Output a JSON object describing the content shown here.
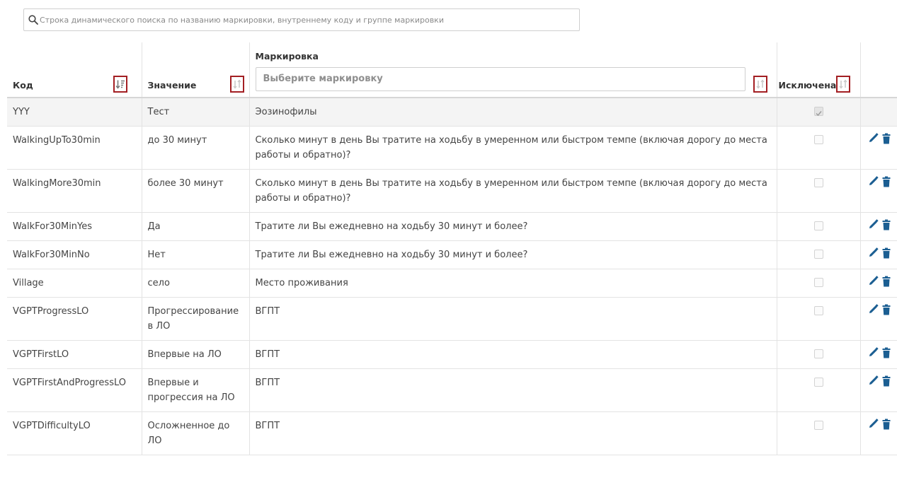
{
  "search": {
    "placeholder": "Строка динамического поиска по названию маркировки, внутреннему коду и группе маркировки"
  },
  "table": {
    "headers": {
      "code": "Код",
      "value": "Значение",
      "marking": "Маркировка",
      "marking_select_placeholder": "Выберите маркировку",
      "excluded": "Исключена"
    },
    "rows": [
      {
        "code": "YYY",
        "value": "Тест",
        "marking": "Эозинофилы",
        "excluded": true
      },
      {
        "code": "WalkingUpTo30min",
        "value": "до 30 минут",
        "marking": "Сколько минут в день Вы тратите на ходьбу в умеренном или быстром темпе (включая дорогу до места работы и обратно)?",
        "excluded": false
      },
      {
        "code": "WalkingMore30min",
        "value": "более 30 минут",
        "marking": "Сколько минут в день Вы тратите на ходьбу в умеренном или быстром темпе (включая дорогу до места работы и обратно)?",
        "excluded": false
      },
      {
        "code": "WalkFor30MinYes",
        "value": "Да",
        "marking": "Тратите ли Вы ежедневно на ходьбу 30 минут и более?",
        "excluded": false
      },
      {
        "code": "WalkFor30MinNo",
        "value": "Нет",
        "marking": "Тратите ли Вы ежедневно на ходьбу 30 минут и более?",
        "excluded": false
      },
      {
        "code": "Village",
        "value": "село",
        "marking": "Место проживания",
        "excluded": false
      },
      {
        "code": "VGPTProgressLO",
        "value": "Прогрессирование в ЛО",
        "marking": "ВГПТ",
        "excluded": false
      },
      {
        "code": "VGPTFirstLO",
        "value": "Впервые на ЛО",
        "marking": "ВГПТ",
        "excluded": false
      },
      {
        "code": "VGPTFirstAndProgressLO",
        "value": "Впервые и прогрессия на ЛО",
        "marking": "ВГПТ",
        "excluded": false
      },
      {
        "code": "VGPTDifficultyLO",
        "value": "Осложненное до ЛО",
        "marking": "ВГПТ",
        "excluded": false
      }
    ]
  },
  "icons": {
    "search": "search-icon",
    "sort_active": "sort-desc-icon",
    "sort": "sort-icon",
    "edit": "pencil-icon",
    "delete": "trash-icon"
  },
  "colors": {
    "sort_border": "#a31f23",
    "action_icons": "#1b5e92",
    "highlight_row": "#f4f4f4"
  }
}
